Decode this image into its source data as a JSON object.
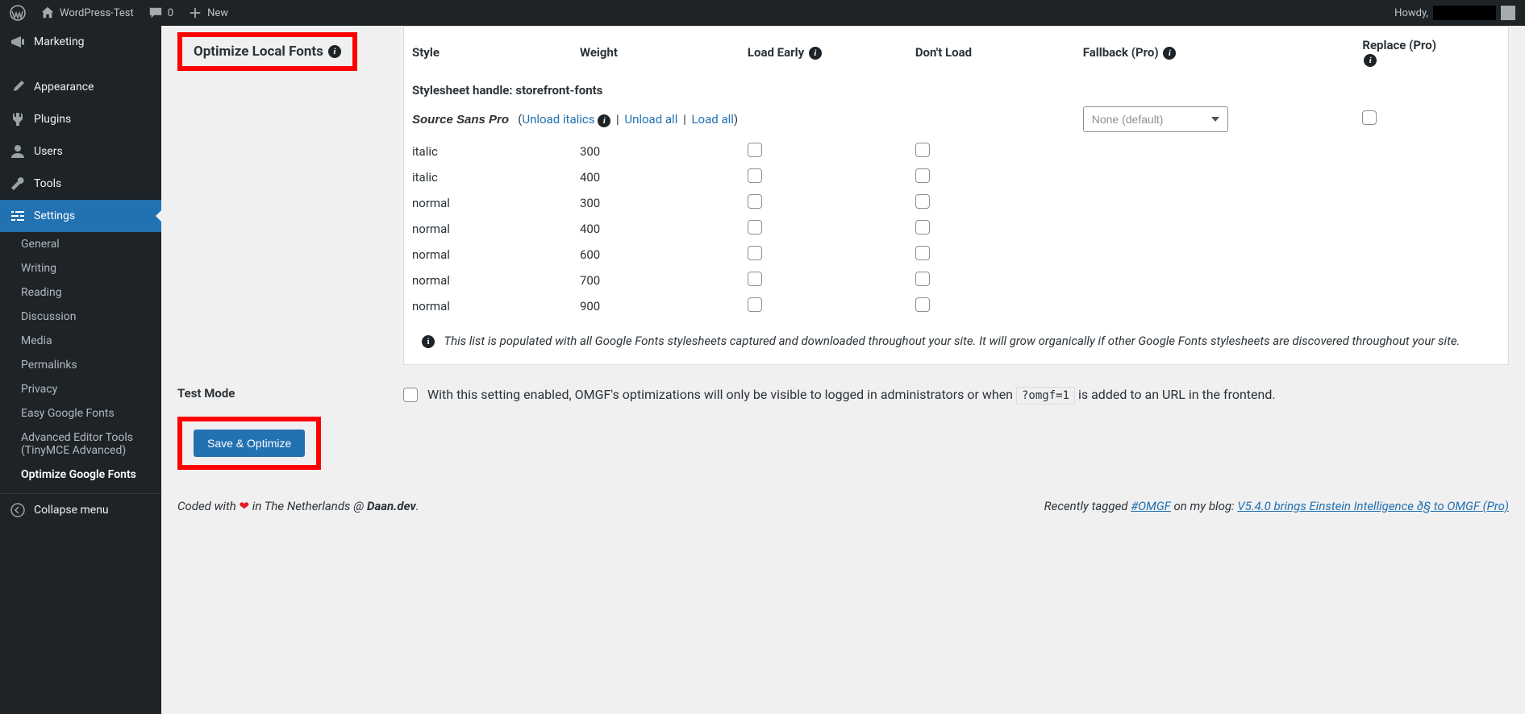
{
  "adminbar": {
    "site_name": "WordPress-Test",
    "comments_count": "0",
    "new_label": "New",
    "howdy": "Howdy,"
  },
  "sidebar": {
    "marketing": "Marketing",
    "appearance": "Appearance",
    "plugins": "Plugins",
    "users": "Users",
    "tools": "Tools",
    "settings": "Settings",
    "sub": {
      "general": "General",
      "writing": "Writing",
      "reading": "Reading",
      "discussion": "Discussion",
      "media": "Media",
      "permalinks": "Permalinks",
      "privacy": "Privacy",
      "easy_google_fonts": "Easy Google Fonts",
      "adv_editor1": "Advanced Editor Tools",
      "adv_editor2": "(TinyMCE Advanced)",
      "optimize_google_fonts": "Optimize Google Fonts"
    },
    "collapse": "Collapse menu"
  },
  "section": {
    "optimize_title": "Optimize Local Fonts",
    "test_mode_label": "Test Mode",
    "save_button": "Save & Optimize"
  },
  "table": {
    "headers": {
      "style": "Style",
      "weight": "Weight",
      "load_early": "Load Early",
      "dont_load": "Don't Load",
      "fallback": "Fallback (Pro)",
      "replace": "Replace (Pro)"
    },
    "handle_prefix": "Stylesheet handle: ",
    "handle_value": "storefront-fonts",
    "family_name": "Source Sans Pro",
    "unload_italics": "Unload italics",
    "unload_all": "Unload all",
    "load_all": "Load all",
    "fallback_default": "None (default)",
    "rows": [
      {
        "style": "italic",
        "weight": "300"
      },
      {
        "style": "italic",
        "weight": "400"
      },
      {
        "style": "normal",
        "weight": "300"
      },
      {
        "style": "normal",
        "weight": "400"
      },
      {
        "style": "normal",
        "weight": "600"
      },
      {
        "style": "normal",
        "weight": "700"
      },
      {
        "style": "normal",
        "weight": "900"
      }
    ],
    "note": "This list is populated with all Google Fonts stylesheets captured and downloaded throughout your site. It will grow organically if other Google Fonts stylesheets are discovered throughout your site."
  },
  "test_mode": {
    "desc_prefix": "With this setting enabled, OMGF's optimizations will only be visible to logged in administrators or when ",
    "code": "?omgf=1",
    "desc_suffix": " is added to an URL in the frontend."
  },
  "footer": {
    "coded_with": "Coded with ",
    "in_nl": " in The Netherlands @ ",
    "daan": "Daan.dev",
    "period": ".",
    "recently_tagged": "Recently tagged ",
    "hashtag": "#OMGF",
    "on_blog": " on my blog: ",
    "post_title": "V5.4.0 brings Einstein Intelligence ð§  to OMGF (Pro)"
  }
}
